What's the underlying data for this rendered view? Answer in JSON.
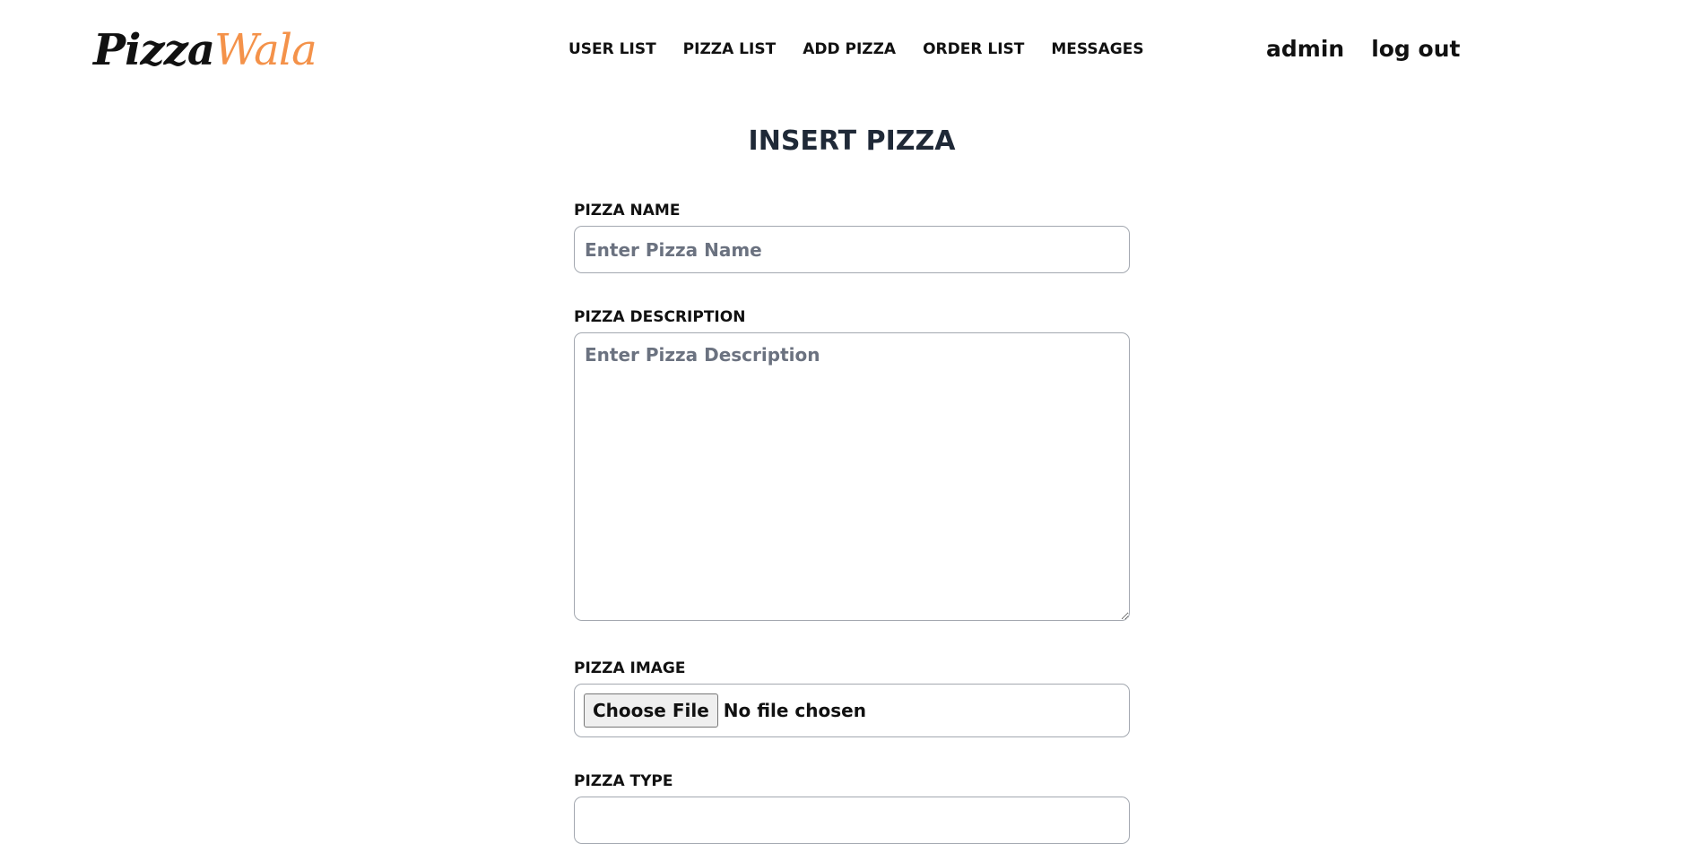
{
  "header": {
    "logo": {
      "part1": "Pizza",
      "part2": "Wala"
    },
    "nav": [
      {
        "label": "USER LIST"
      },
      {
        "label": "PIZZA LIST"
      },
      {
        "label": "ADD PIZZA"
      },
      {
        "label": "ORDER LIST"
      },
      {
        "label": "MESSAGES"
      }
    ],
    "user": {
      "name": "admin",
      "logout": "log out"
    }
  },
  "page": {
    "title": "INSERT PIZZA"
  },
  "form": {
    "name": {
      "label": "PIZZA NAME",
      "placeholder": "Enter Pizza Name",
      "value": ""
    },
    "description": {
      "label": "PIZZA DESCRIPTION",
      "placeholder": "Enter Pizza Description",
      "value": ""
    },
    "image": {
      "label": "PIZZA IMAGE",
      "button": "Choose File",
      "status": "No file chosen"
    },
    "type": {
      "label": "PIZZA TYPE"
    }
  },
  "colors": {
    "logo_accent": "#f4924a",
    "title": "#1f2937",
    "input_border": "#a3a8b0",
    "placeholder": "#6b7280"
  }
}
